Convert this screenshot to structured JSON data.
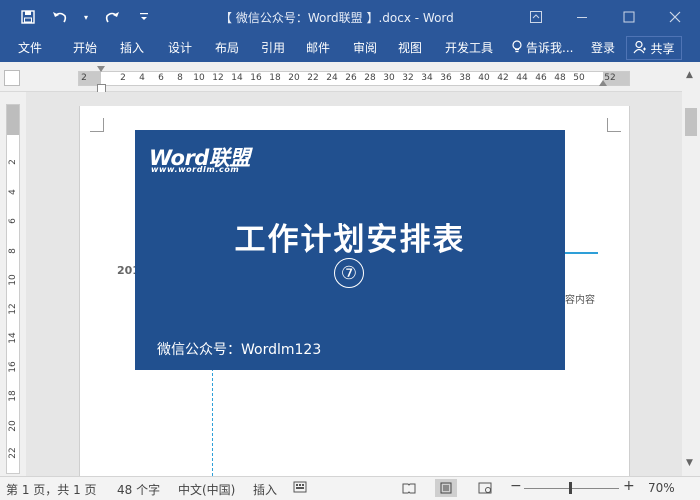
{
  "window": {
    "title": "【 微信公众号：Word联盟 】.docx - Word",
    "qat": {
      "save_icon": "save-icon",
      "undo_icon": "undo-icon",
      "redo_icon": "redo-icon",
      "customize_icon": "chevron-down-icon"
    },
    "controls": {
      "ribbon_display": "ribbon-display-icon",
      "minimize": "minimize-icon",
      "maximize": "maximize-icon",
      "close": "close-icon"
    }
  },
  "ribbon": {
    "tabs": [
      "文件",
      "开始",
      "插入",
      "设计",
      "布局",
      "引用",
      "邮件",
      "审阅",
      "视图",
      "开发工具"
    ],
    "tell_me": "告诉我...",
    "login": "登录",
    "share": "共享"
  },
  "ruler": {
    "corner_value": "2",
    "ticks": [
      "2",
      "4",
      "6",
      "8",
      "10",
      "12",
      "14",
      "16",
      "18",
      "20",
      "22",
      "24",
      "26",
      "28",
      "30",
      "32",
      "34",
      "36",
      "38",
      "40",
      "42",
      "44",
      "46",
      "48",
      "50",
      "52"
    ],
    "vticks": [
      "2",
      "4",
      "6",
      "8",
      "10",
      "12",
      "14",
      "16",
      "18",
      "20",
      "22"
    ]
  },
  "document": {
    "banner": {
      "logo_text": "Word联盟",
      "logo_url": "www.wordlm.com",
      "title": "工作计划安排表",
      "number": "⑦",
      "footer": "微信公众号：Wordlm123",
      "background": "#21508f"
    },
    "year_fragment": "201",
    "side_text": "容内容"
  },
  "status_bar": {
    "page_info": "第 1 页，共 1 页",
    "word_count": "48 个字",
    "language": "中文(中国)",
    "mode": "插入",
    "zoom": "70%",
    "zoom_minus": "−",
    "zoom_plus": "+"
  },
  "colors": {
    "accent": "#2b579a",
    "guide": "#2e9fd8"
  }
}
